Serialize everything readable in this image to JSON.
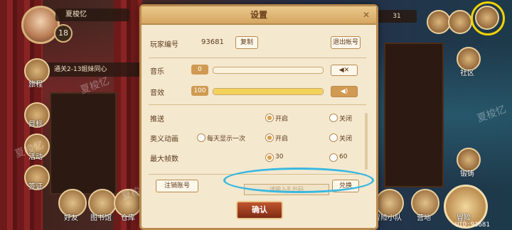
{
  "hud": {
    "player_name": "夏梭忆",
    "level": "18",
    "quest": "通关2-13姐妹同心",
    "currency": "31",
    "uid_label": "UID:93681"
  },
  "side_menu": [
    {
      "label": "旅程"
    },
    {
      "label": "目标"
    },
    {
      "label": "活动"
    },
    {
      "label": "签证"
    }
  ],
  "bottom_menu": [
    {
      "label": "好友"
    },
    {
      "label": "图书馆"
    },
    {
      "label": "仓库"
    },
    {
      "label": "冒险小队"
    },
    {
      "label": "营地"
    },
    {
      "label": "冒险"
    }
  ],
  "right_menu": [
    {
      "label": "社区"
    },
    {
      "label": "锻铸"
    }
  ],
  "watermark": "夏梭忆",
  "dialog": {
    "title": "设置",
    "player_id_label": "玩家编号",
    "player_id": "93681",
    "copy_btn": "复制",
    "logout_btn": "退出帐号",
    "music_label": "音乐",
    "music_value": "0",
    "music_fill": 0,
    "sfx_label": "音效",
    "sfx_value": "100",
    "sfx_fill": 1,
    "push_label": "推送",
    "push_on": "开启",
    "push_off": "关闭",
    "ult_label": "奥义动画",
    "ult_daily": "每天显示一次",
    "ult_on": "开启",
    "ult_off": "关闭",
    "fps_label": "最大帧数",
    "fps_30": "30",
    "fps_60": "60",
    "cancel_account_btn": "注销账号",
    "gift_placeholder": "请输入礼包码",
    "redeem_btn": "兑换",
    "confirm_btn": "确认"
  },
  "colors": {
    "dialog_bg": "#f4e8cf",
    "accent_border": "#b98a4e",
    "confirm_red": "#a0401e",
    "highlight_yellow": "#f3d200",
    "highlight_blue": "#39b8e0"
  }
}
